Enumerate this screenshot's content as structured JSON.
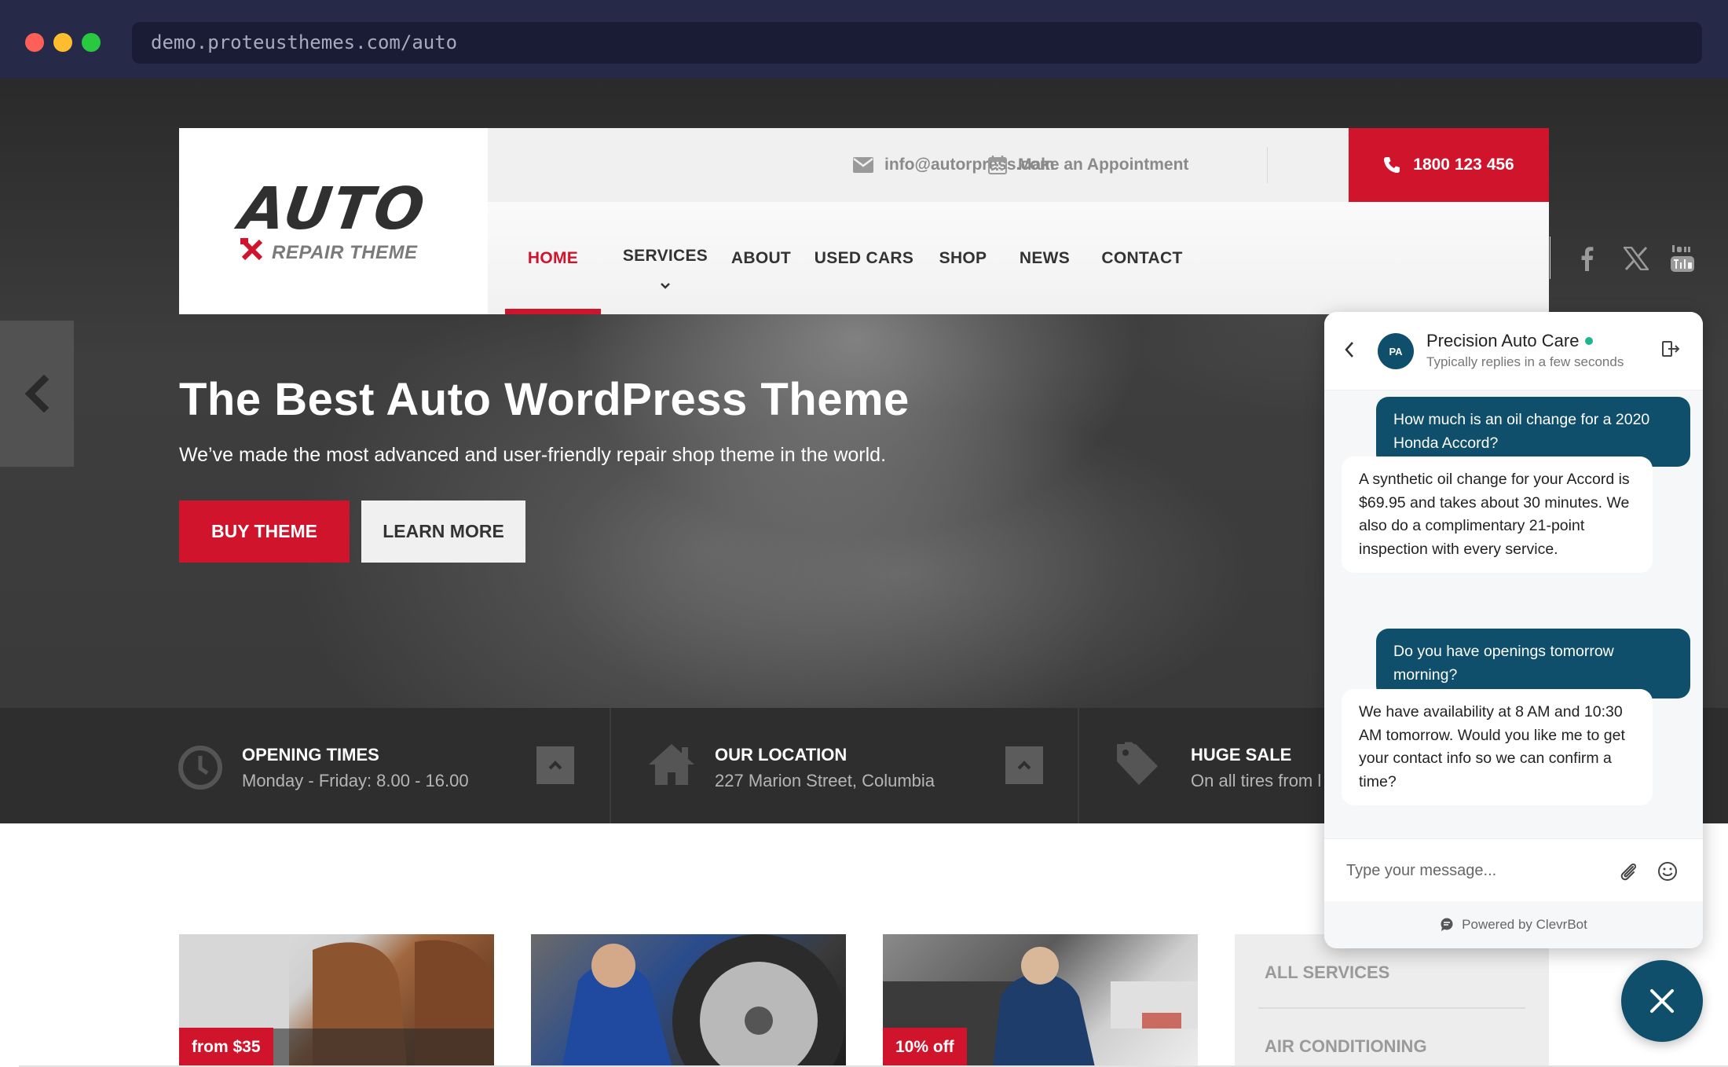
{
  "browser": {
    "url": "demo.proteusthemes.com/auto",
    "traffic_colors": [
      "#fe5f57",
      "#febc2e",
      "#28c840"
    ]
  },
  "header": {
    "logo_word": "AUTO",
    "logo_tagline": "REPAIR THEME",
    "email": "info@autorpress.com",
    "appointment": "Make an Appointment",
    "phone": "1800 123 456"
  },
  "nav": {
    "items": [
      "HOME",
      "SERVICES",
      "ABOUT",
      "USED CARS",
      "SHOP",
      "NEWS",
      "CONTACT"
    ],
    "active": "HOME"
  },
  "social": [
    "facebook-icon",
    "x-icon",
    "youtube-icon"
  ],
  "hero": {
    "title": "The Best Auto WordPress Theme",
    "subtitle": "We’ve made the most advanced and user-friendly repair shop theme in the world.",
    "buy_label": "BUY THEME",
    "learn_label": "LEARN MORE"
  },
  "info": [
    {
      "title": "OPENING TIMES",
      "text": "Monday - Friday: 8.00 - 16.00",
      "icon": "clock-icon"
    },
    {
      "title": "OUR LOCATION",
      "text": "227 Marion Street, Columbia",
      "icon": "house-icon"
    },
    {
      "title": "HUGE SALE",
      "text": "On all tires from l",
      "icon": "tag-icon"
    }
  ],
  "cards": [
    {
      "badge": "from $35"
    },
    {
      "badge": ""
    },
    {
      "badge": "10% off"
    }
  ],
  "services": [
    "ALL SERVICES",
    "AIR CONDITIONING"
  ],
  "chat": {
    "avatar_initials": "PA",
    "name": "Precision Auto Care",
    "status": "Typically replies in a few seconds",
    "messages": [
      {
        "from": "user",
        "text": "How much is an oil change for a 2020 Honda Accord?"
      },
      {
        "from": "bot",
        "text": "A synthetic oil change for your Accord is $69.95 and takes about 30 minutes. We also do a complimentary 21-point inspection with every service."
      },
      {
        "from": "user",
        "text": "Do you have openings tomorrow morning?"
      },
      {
        "from": "bot",
        "text": "We have availability at 8 AM and 10:30 AM tomorrow. Would you like me to get your contact info so we can confirm a time?"
      }
    ],
    "input_placeholder": "Type your message...",
    "powered_by": "Powered by ClevrBot"
  },
  "colors": {
    "brand_red": "#d0142c",
    "chat_teal": "#0f4f6b",
    "online_green": "#1fb58f"
  }
}
